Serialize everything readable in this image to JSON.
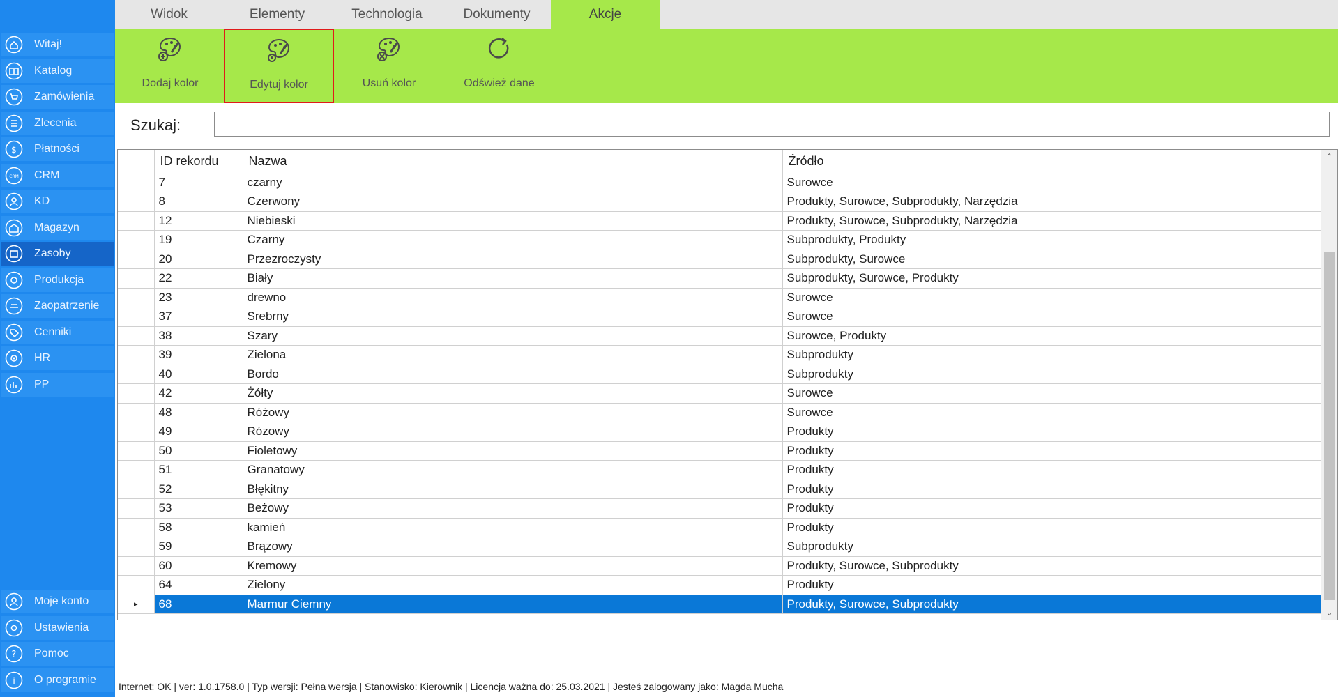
{
  "sidebar": {
    "items": [
      {
        "label": "Witaj!",
        "icon": "home-icon"
      },
      {
        "label": "Katalog",
        "icon": "book-icon"
      },
      {
        "label": "Zamówienia",
        "icon": "cart-icon"
      },
      {
        "label": "Zlecenia",
        "icon": "list-icon"
      },
      {
        "label": "Płatności",
        "icon": "dollar-icon"
      },
      {
        "label": "CRM",
        "icon": "crm-icon"
      },
      {
        "label": "KD",
        "icon": "user-icon"
      },
      {
        "label": "Magazyn",
        "icon": "warehouse-icon"
      },
      {
        "label": "Zasoby",
        "icon": "box-icon"
      },
      {
        "label": "Produkcja",
        "icon": "production-icon"
      },
      {
        "label": "Zaopatrzenie",
        "icon": "supply-icon"
      },
      {
        "label": "Cenniki",
        "icon": "tag-icon"
      },
      {
        "label": "HR",
        "icon": "hr-icon"
      },
      {
        "label": "PP",
        "icon": "chart-icon"
      }
    ],
    "active": "Zasoby",
    "bottom_items": [
      {
        "label": "Moje konto",
        "icon": "account-icon"
      },
      {
        "label": "Ustawienia",
        "icon": "settings-icon"
      },
      {
        "label": "Pomoc",
        "icon": "help-icon"
      },
      {
        "label": "O programie",
        "icon": "info-icon"
      }
    ]
  },
  "tabs": [
    {
      "label": "Widok"
    },
    {
      "label": "Elementy"
    },
    {
      "label": "Technologia"
    },
    {
      "label": "Dokumenty"
    },
    {
      "label": "Akcje"
    }
  ],
  "active_tab": "Akcje",
  "ribbon": [
    {
      "label": "Dodaj kolor",
      "icon": "add-color-icon"
    },
    {
      "label": "Edytuj kolor",
      "icon": "edit-color-icon"
    },
    {
      "label": "Usuń kolor",
      "icon": "delete-color-icon"
    },
    {
      "label": "Odśwież dane",
      "icon": "refresh-icon"
    }
  ],
  "search": {
    "label": "Szukaj:",
    "value": "",
    "placeholder": ""
  },
  "table": {
    "columns": [
      "ID rekordu",
      "Nazwa",
      "Źródło"
    ],
    "rows": [
      [
        "7",
        "czarny",
        "Surowce"
      ],
      [
        "8",
        "Czerwony",
        "Produkty, Surowce, Subprodukty, Narzędzia"
      ],
      [
        "12",
        "Niebieski",
        "Produkty, Surowce, Subprodukty, Narzędzia"
      ],
      [
        "19",
        "Czarny",
        "Subprodukty, Produkty"
      ],
      [
        "20",
        "Przezroczysty",
        "Subprodukty, Surowce"
      ],
      [
        "22",
        "Biały",
        "Subprodukty, Surowce, Produkty"
      ],
      [
        "23",
        "drewno",
        "Surowce"
      ],
      [
        "37",
        "Srebrny",
        "Surowce"
      ],
      [
        "38",
        "Szary",
        "Surowce, Produkty"
      ],
      [
        "39",
        "Zielona",
        "Subprodukty"
      ],
      [
        "40",
        "Bordo",
        "Subprodukty"
      ],
      [
        "42",
        "Żółty",
        "Surowce"
      ],
      [
        "48",
        "Różowy",
        "Surowce"
      ],
      [
        "49",
        "Rózowy",
        "Produkty"
      ],
      [
        "50",
        "Fioletowy",
        "Produkty"
      ],
      [
        "51",
        "Granatowy",
        "Produkty"
      ],
      [
        "52",
        "Błękitny",
        "Produkty"
      ],
      [
        "53",
        "Beżowy",
        "Produkty"
      ],
      [
        "58",
        "kamień",
        "Produkty"
      ],
      [
        "59",
        "Brązowy",
        "Subprodukty"
      ],
      [
        "60",
        "Kremowy",
        "Produkty, Surowce, Subprodukty"
      ],
      [
        "64",
        "Zielony",
        "Produkty"
      ],
      [
        "68",
        "Marmur Ciemny",
        "Produkty, Surowce, Subprodukty"
      ]
    ],
    "selected_row_index": 22
  },
  "status": {
    "text": "Internet: OK  |   ver: 1.0.1758.0   |   Typ wersji: Pełna wersja   |   Stanowisko: Kierownik   |   Licencja ważna do: 25.03.2021   |   Jesteś zalogowany jako: Magda Mucha"
  },
  "colors": {
    "sidebar_bg": "#1e88ee",
    "ribbon_bg": "#a6e84a",
    "selection": "#0a78d7",
    "highlight_border": "#e01b1b"
  }
}
